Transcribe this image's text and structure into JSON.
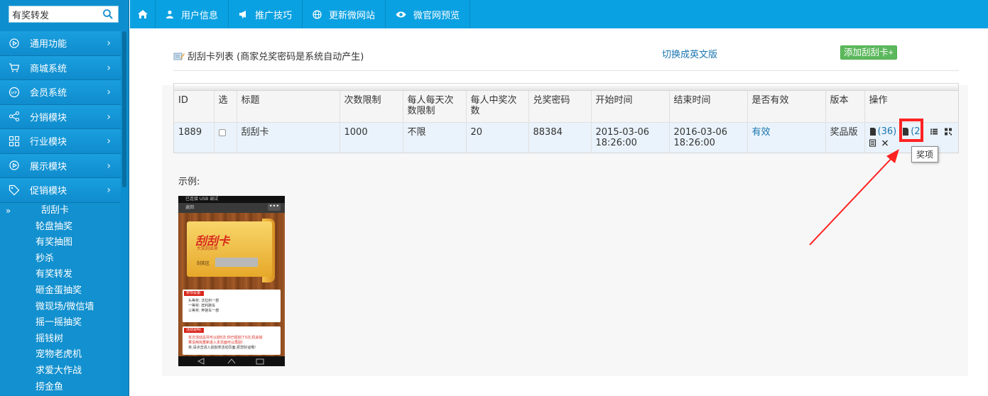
{
  "sidebar": {
    "search": {
      "value": "有奖转发"
    },
    "menu": [
      {
        "label": "通用功能",
        "icon": "play-circle-icon"
      },
      {
        "label": "商城系统",
        "icon": "cart-icon"
      },
      {
        "label": "会员系统",
        "icon": "vip-icon"
      },
      {
        "label": "分销模块",
        "icon": "share-icon"
      },
      {
        "label": "行业模块",
        "icon": "grid-icon"
      },
      {
        "label": "展示模块",
        "icon": "play-circle-icon"
      },
      {
        "label": "促销模块",
        "icon": "tag-icon"
      }
    ],
    "submenu": {
      "active_marker": "»",
      "items": [
        "刮刮卡",
        "轮盘抽奖",
        "有奖抽图",
        "秒杀",
        "有奖转发",
        "砸金蛋抽奖",
        "微现场/微信墙",
        "摇一摇抽奖",
        "摇钱树",
        "宠物老虎机",
        "求爱大作战",
        "捞金鱼"
      ]
    }
  },
  "topnav": {
    "items": [
      {
        "label": "用户信息",
        "icon": "user-icon"
      },
      {
        "label": "推广技巧",
        "icon": "megaphone-icon"
      },
      {
        "label": "更新微网站",
        "icon": "globe-icon"
      },
      {
        "label": "微官网预览",
        "icon": "eye-icon"
      }
    ]
  },
  "page": {
    "title": "刮刮卡列表 (商家兑奖密码是系统自动产生)",
    "switch_link": "切换成英文版",
    "add_button": "添加刮刮卡+"
  },
  "table": {
    "headers": [
      "ID",
      "选",
      "标题",
      "次数限制",
      "每人每天次数限制",
      "每人中奖次数",
      "兑奖密码",
      "开始时间",
      "结束时间",
      "是否有效",
      "版本",
      "操作"
    ],
    "rows": [
      {
        "id": "1889",
        "title": "刮刮卡",
        "limit": "1000",
        "daily_limit": "不限",
        "win_limit": "20",
        "password": "88384",
        "start_date": "2015-03-06",
        "start_time": "18:26:00",
        "end_date": "2016-03-06",
        "end_time": "18:26:00",
        "valid": "有效",
        "version": "奖品版",
        "ops_count": "(36)",
        "ops_count2": "(2"
      }
    ]
  },
  "tooltip": "奖项",
  "example": {
    "label": "示例:",
    "phone": {
      "status": "已连接 USB 调试",
      "back": "返回",
      "dots": "•••",
      "brand": "刮刮卡",
      "sub": "大奖刮出来",
      "area_label": "刮奖区",
      "prize_badge": "奖项设置:",
      "prize_lines": [
        "头等奖: 法拉利一部",
        "一等奖: 宾利跑车",
        "三等奖: 奔驰车一部"
      ],
      "desc_badge": "活动说明:",
      "desc_lines": [
        "本次活动总共可以刮5次,你已经刮了0次,机会如",
        "果没用完重新进入本页面可以再刮!",
        "亲,请点击进入刮刮奖活动页面,祝您好运哦!"
      ]
    }
  },
  "colors": {
    "sidebar": "#0d8fcf",
    "topnav": "#0aa1e2",
    "accent_green": "#5cb85c",
    "highlight_red": "#ff2222"
  }
}
